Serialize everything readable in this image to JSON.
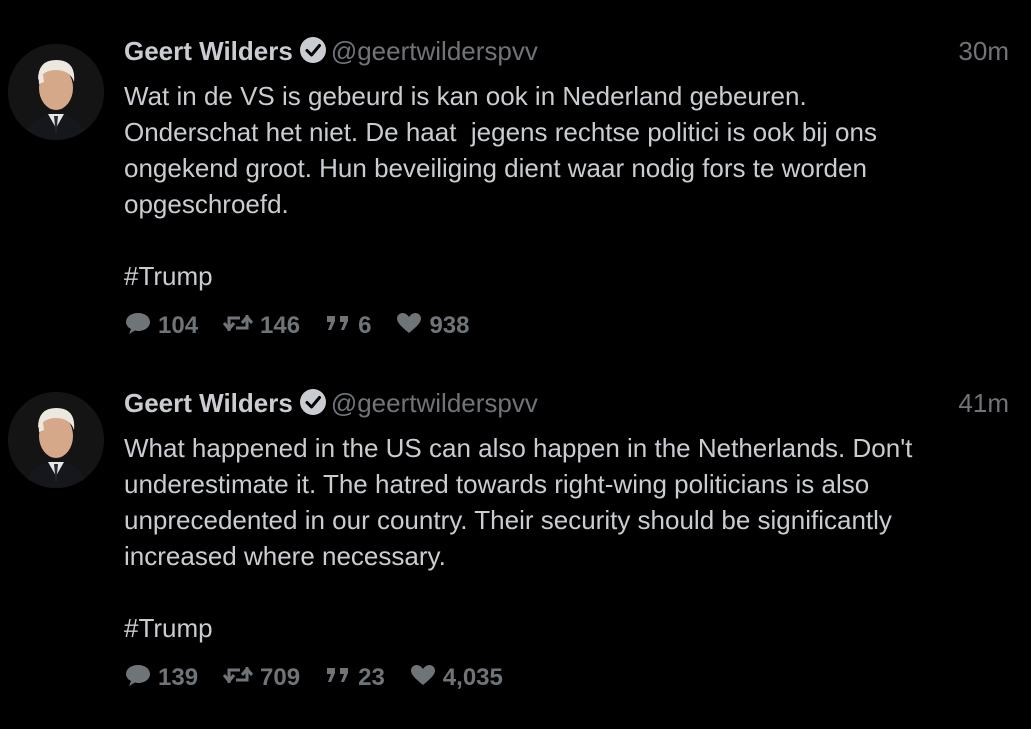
{
  "colors": {
    "background": "#000000",
    "text": "#c9cdd1",
    "muted": "#6f7479"
  },
  "tweets": [
    {
      "display_name": "Geert Wilders",
      "verified_icon": "verified-check-icon",
      "handle": "@geertwilderspvv",
      "time": "30m",
      "text": "Wat in de VS is gebeurd is kan ook in Nederland gebeuren.\nOnderschat het niet. De haat  jegens rechtse politici is ook bij ons\nongekend groot. Hun beveiliging dient waar nodig fors te worden\nopgeschroefd.",
      "hashtag": "#Trump",
      "replies": "104",
      "retweets": "146",
      "quotes": "6",
      "likes": "938"
    },
    {
      "display_name": "Geert Wilders",
      "verified_icon": "verified-check-icon",
      "handle": "@geertwilderspvv",
      "time": "41m",
      "text": "What happened in the US can also happen in the Netherlands. Don't\nunderestimate it. The hatred towards right-wing politicians is also\nunprecedented in our country. Their security should be significantly\nincreased where necessary.",
      "hashtag": "#Trump",
      "replies": "139",
      "retweets": "709",
      "quotes": "23",
      "likes": "4,035"
    }
  ]
}
